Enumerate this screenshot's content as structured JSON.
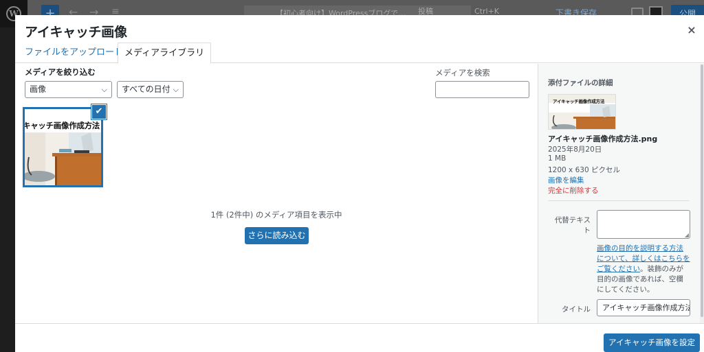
{
  "background": {
    "document_title": "【初心者向け】WordPressブログで…",
    "post_label": "投稿",
    "k_label": "Ctrl+K",
    "save_draft": "下書き保存",
    "publish": "公開"
  },
  "modal": {
    "title": "アイキャッチ画像",
    "close": "×",
    "tabs": [
      {
        "label": "ファイルをアップロード"
      },
      {
        "label": "メディアライブラリ"
      }
    ]
  },
  "browser": {
    "filter_label": "メディアを絞り込む",
    "type_filter": "画像",
    "date_filter": "すべての日付",
    "search_label": "メディアを検索",
    "search_value": "",
    "attachment_title": "キャッチ画像作成方法",
    "count_text": "1件 (2件中) のメディア項目を表示中",
    "load_more": "さらに読み込む"
  },
  "details": {
    "heading": "添付ファイルの詳細",
    "thumb_title": "アイキャッチ画像作成方法",
    "filename": "アイキャッチ画像作成方法.png",
    "date": "2025年8月20日",
    "size": "1 MB",
    "dimensions": "1200 x 630 ピクセル",
    "edit_link": "画像を編集",
    "delete_link": "完全に削除する",
    "alt_label": "代替テキスト",
    "alt_value": "",
    "help_link": "画像の目的を説明する方法について、詳しくはこちらをご覧ください",
    "help_suffix": "。装飾のみが目的の画像であれば、空欄にしてください。",
    "title_label": "タイトル",
    "title_value": "アイキャッチ画像作成方法"
  },
  "footer": {
    "set_button": "アイキャッチ画像を設定"
  },
  "colors": {
    "accent": "#2271b1",
    "danger": "#d63638",
    "sidebar_bg": "#f6f7f7"
  }
}
